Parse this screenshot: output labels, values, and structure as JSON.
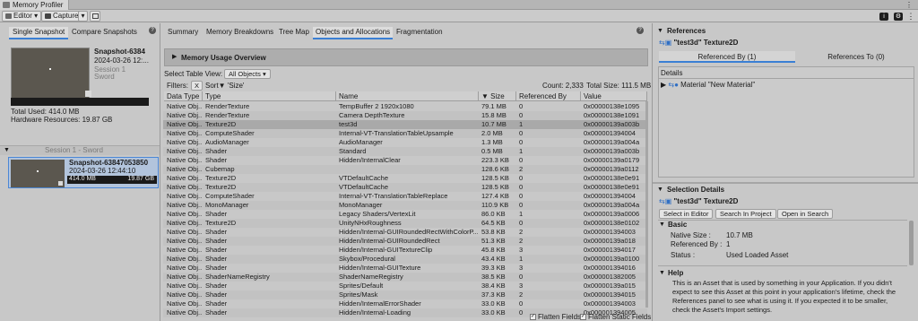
{
  "window": {
    "title": "Memory Profiler"
  },
  "toolbar": {
    "editor_label": "Editor ▾",
    "capture_label": "Capture",
    "capture_arrow": "▾"
  },
  "left": {
    "tabs": [
      "Single Snapshot",
      "Compare Snapshots"
    ],
    "snapshot_a": {
      "name": "Snapshot-6384",
      "date": "2024-03-26 12:...",
      "session": "Session 1",
      "project": "Sword",
      "total_used": "Total Used: 414.0 MB",
      "hardware": "Hardware Resources: 19.87 GB"
    },
    "session_header": "Session 1 - Sword",
    "snapshot_b": {
      "name": "Snapshot-63847053850",
      "date": "2024-03-26 12:44:10",
      "used": "414.0 MB",
      "total": "19.87 GB"
    }
  },
  "center": {
    "tabs": [
      "Summary",
      "Memory Breakdowns",
      "Tree Map",
      "Objects and Allocations",
      "Fragmentation"
    ],
    "overview_label": "Memory Usage Overview",
    "table_view_label": "Select Table View:",
    "table_view_value": "All Objects",
    "filters_label": "Filters:",
    "filter_x": "X",
    "sort_label": "Sort▼ 'Size'",
    "count": "Count: 2,333",
    "total_size": "Total Size: 111.5 MB",
    "columns": [
      "Data Type",
      "Type",
      "Name",
      "▼ Size",
      "Referenced By",
      "Value"
    ],
    "rows": [
      [
        "Native Obj...",
        "RenderTexture",
        "TempBuffer 2 1920x1080",
        "79.1 MB",
        "0",
        "0x00000138e1095"
      ],
      [
        "Native Obj...",
        "RenderTexture",
        "Camera DepthTexture",
        "15.8 MB",
        "0",
        "0x00000138e1091"
      ],
      [
        "Native Obj...",
        "Texture2D",
        "test3d",
        "10.7 MB",
        "1",
        "0x00000139a003b"
      ],
      [
        "Native Obj...",
        "ComputeShader",
        "Internal-VT-TranslationTableUpsample",
        "2.0 MB",
        "0",
        "0x000001394004"
      ],
      [
        "Native Obj...",
        "AudioManager",
        "AudioManager",
        "1.3 MB",
        "0",
        "0x00000139a004a"
      ],
      [
        "Native Obj...",
        "Shader",
        "Standard",
        "0.5 MB",
        "1",
        "0x00000139a003b"
      ],
      [
        "Native Obj...",
        "Shader",
        "Hidden/InternalClear",
        "223.3 KB",
        "0",
        "0x00000139a0179"
      ],
      [
        "Native Obj...",
        "Cubemap",
        "",
        "128.6 KB",
        "2",
        "0x00000139a0112"
      ],
      [
        "Native Obj...",
        "Texture2D",
        "VTDefaultCache",
        "128.5 KB",
        "0",
        "0x00000138e0e91"
      ],
      [
        "Native Obj...",
        "Texture2D",
        "VTDefaultCache",
        "128.5 KB",
        "0",
        "0x00000138e0e91"
      ],
      [
        "Native Obj...",
        "ComputeShader",
        "Internal-VT-TranslationTableReplace",
        "127.4 KB",
        "0",
        "0x000001394004"
      ],
      [
        "Native Obj...",
        "MonoManager",
        "MonoManager",
        "110.9 KB",
        "0",
        "0x00000139a004a"
      ],
      [
        "Native Obj...",
        "Shader",
        "Legacy Shaders/VertexLit",
        "86.0 KB",
        "1",
        "0x00000139a0006"
      ],
      [
        "Native Obj...",
        "Texture2D",
        "UnityNHxRoughness",
        "64.5 KB",
        "0",
        "0x00000138e0102"
      ],
      [
        "Native Obj...",
        "Shader",
        "Hidden/Internal-GUIRoundedRectWithColorP...",
        "53.8 KB",
        "2",
        "0x000001394003"
      ],
      [
        "Native Obj...",
        "Shader",
        "Hidden/Internal-GUIRoundedRect",
        "51.3 KB",
        "2",
        "0x00000139a018"
      ],
      [
        "Native Obj...",
        "Shader",
        "Hidden/Internal-GUITextureClip",
        "45.8 KB",
        "3",
        "0x000001394017"
      ],
      [
        "Native Obj...",
        "Shader",
        "Skybox/Procedural",
        "43.4 KB",
        "1",
        "0x00000139a0100"
      ],
      [
        "Native Obj...",
        "Shader",
        "Hidden/Internal-GUITexture",
        "39.3 KB",
        "3",
        "0x000001394016"
      ],
      [
        "Native Obj...",
        "ShaderNameRegistry",
        "ShaderNameRegistry",
        "38.5 KB",
        "0",
        "0x000001382005"
      ],
      [
        "Native Obj...",
        "Shader",
        "Sprites/Default",
        "38.4 KB",
        "3",
        "0x00000139a015"
      ],
      [
        "Native Obj...",
        "Shader",
        "Sprites/Mask",
        "37.3 KB",
        "2",
        "0x000001394015"
      ],
      [
        "Native Obj...",
        "Shader",
        "Hidden/InternalErrorShader",
        "33.0 KB",
        "0",
        "0x000001394003"
      ],
      [
        "Native Obj...",
        "Shader",
        "Hidden/Internal-Loading",
        "33.0 KB",
        "0",
        "0x000001394005"
      ]
    ],
    "flatten_fields": "Flatten Fields",
    "flatten_static": "Flatten Static Fields"
  },
  "right": {
    "references_title": "References",
    "ref_item": "\"test3d\" Texture2D",
    "tabs": [
      "Referenced By (1)",
      "References To (0)"
    ],
    "details_label": "Details",
    "detail_item": "Material \"New Material\"",
    "selection_title": "Selection Details",
    "sel_item": "\"test3d\" Texture2D",
    "buttons": [
      "Select in Editor",
      "Search In Project",
      "Open in Search"
    ],
    "basic_label": "Basic",
    "props": [
      {
        "k": "Native Size :",
        "v": "10.7 MB"
      },
      {
        "k": "Referenced By :",
        "v": "1"
      },
      {
        "k": "Status :",
        "v": "Used Loaded Asset"
      }
    ],
    "help_label": "Help",
    "help_text": "This is an Asset that is used by something in your Application. If you didn't expect to see this Asset at this point in your application's lifetime, check the References panel to see what is using it. If you expected it to be smaller, check the Asset's Import settings."
  }
}
